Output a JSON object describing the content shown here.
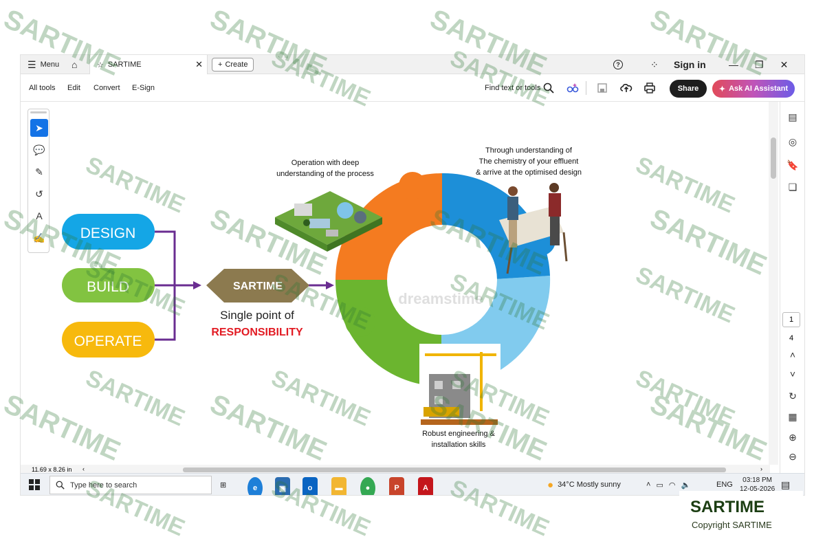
{
  "window": {
    "menu_label": "Menu",
    "tab_title": "SARTIME",
    "create_label": "Create",
    "signin_label": "Sign in"
  },
  "toolbar": {
    "items": [
      "All tools",
      "Edit",
      "Convert",
      "E-Sign"
    ],
    "find_label": "Find text or tools",
    "share_label": "Share",
    "ai_label": "Ask AI Assistant"
  },
  "document": {
    "pills": [
      "DESIGN",
      "BUILD",
      "OPERATE"
    ],
    "center_label": "SARTIME",
    "tagline_1": "Single point of",
    "tagline_2": "RESPONSIBILITY",
    "op_caption_1": "Operation with deep",
    "op_caption_2": "understanding of the process",
    "design_caption_1": "Through understanding of",
    "design_caption_2": "The chemistry of your effluent",
    "design_caption_3": "& arrive at the optimised design",
    "build_caption_1": "Robust engineering &",
    "build_caption_2": "installation skills",
    "stock_watermark": "dreamstime",
    "colors": {
      "design_pill": "#14a6e6",
      "build_pill": "#82c341",
      "operate_pill": "#f7b90d",
      "connector": "#6a2d91",
      "hexagon": "#8c7a4f",
      "responsibility": "#e21b23",
      "puzzle_orange": "#f47b20",
      "puzzle_blue": "#1d8fd8",
      "puzzle_green": "#6bb52f"
    }
  },
  "page_nav": {
    "current": "1",
    "total": "4"
  },
  "status": {
    "page_size": "11.69 x 8.26 in"
  },
  "taskbar": {
    "search_placeholder": "Type here to search",
    "weather": "34°C  Mostly sunny",
    "lang": "ENG",
    "time": "03:18 PM",
    "date": "12-05-2026"
  },
  "watermark": {
    "text": "SARTIME",
    "copyright_name": "SARTIME",
    "copyright_sub": "Copyright SARTIME"
  }
}
